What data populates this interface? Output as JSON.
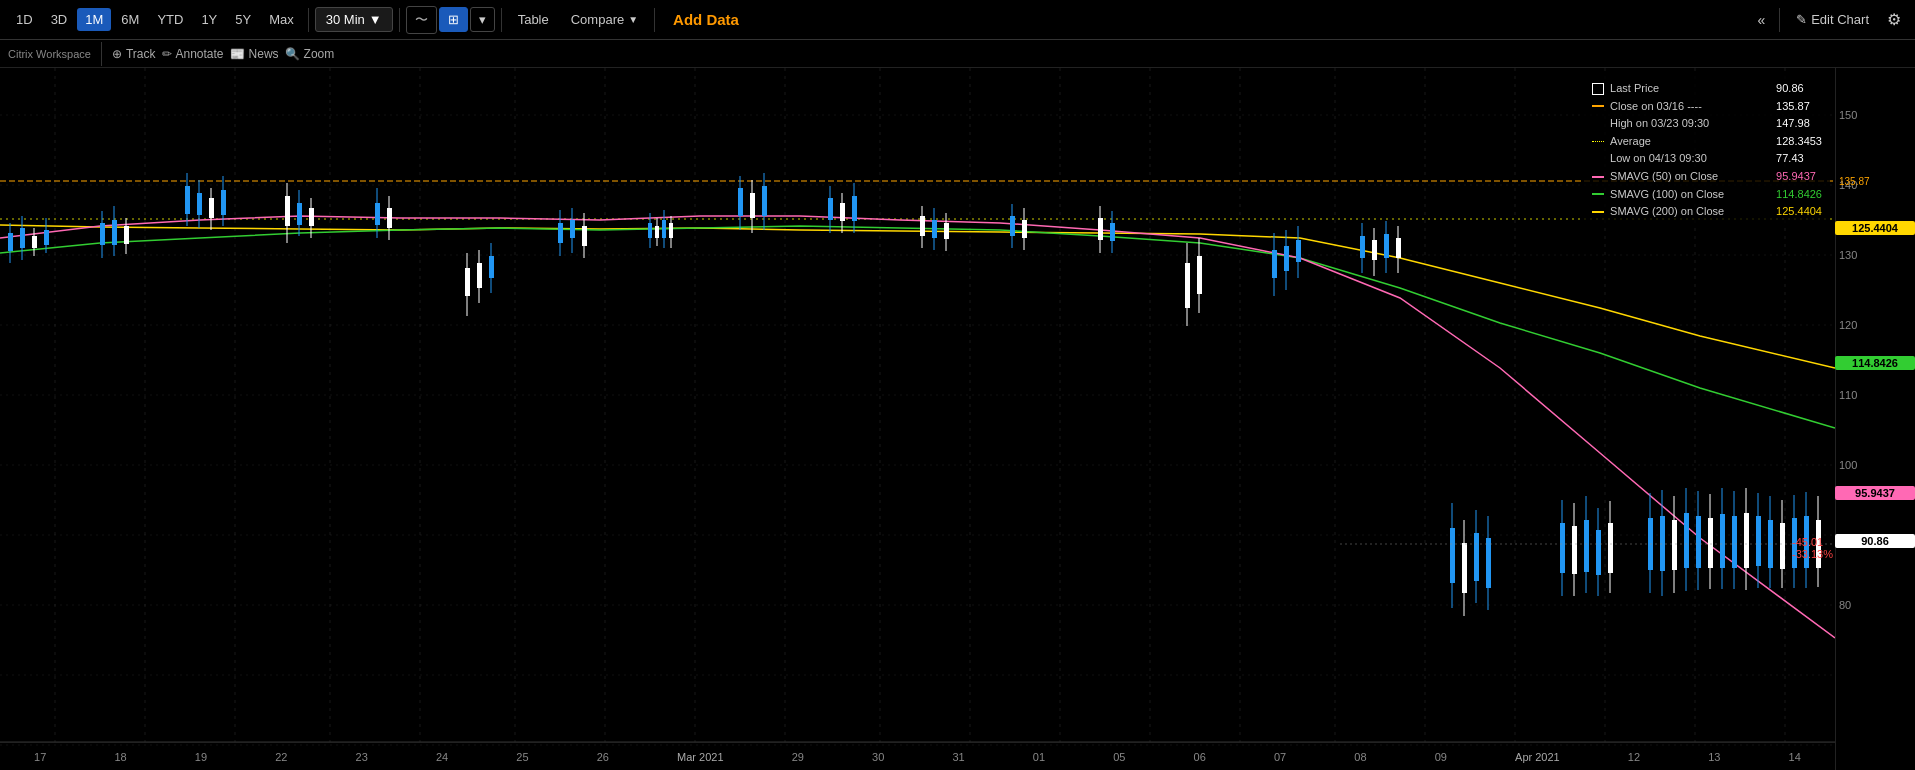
{
  "toolbar": {
    "timeframes": [
      "1D",
      "3D",
      "1M",
      "6M",
      "YTD",
      "1Y",
      "5Y",
      "Max"
    ],
    "active_timeframe": "1M",
    "interval": "30 Min",
    "table_label": "Table",
    "compare_label": "Compare",
    "add_data_label": "Add Data",
    "edit_chart_label": "Edit Chart"
  },
  "sub_toolbar": {
    "workspace_label": "Citrix Workspace",
    "track_label": "Track",
    "annotate_label": "Annotate",
    "news_label": "News",
    "zoom_label": "Zoom"
  },
  "legend": {
    "last_price_label": "Last Price",
    "last_price_value": "90.86",
    "close_label": "Close on 03/16 ----",
    "close_value": "135.87",
    "high_label": "High on 03/23 09:30",
    "high_value": "147.98",
    "avg_label": "Average",
    "avg_value": "128.3453",
    "low_label": "Low on 04/13 09:30",
    "low_value": "77.43",
    "smavg50_label": "SMAVG (50)  on Close",
    "smavg50_value": "95.9437",
    "smavg100_label": "SMAVG (100) on Close",
    "smavg100_value": "114.8426",
    "smavg200_label": "SMAVG (200) on Close",
    "smavg200_value": "125.4404"
  },
  "price_axis": {
    "labels": [
      "150",
      "140",
      "130",
      "120",
      "110",
      "100",
      "80"
    ],
    "values": [
      150,
      140,
      130,
      120,
      110,
      100,
      80
    ]
  },
  "x_axis": {
    "labels": [
      "17",
      "18",
      "19",
      "22",
      "23",
      "24",
      "25",
      "26",
      "29",
      "30",
      "31",
      "01",
      "05",
      "06",
      "07",
      "08",
      "09",
      "12",
      "13",
      "14"
    ],
    "mar_label": "Mar 2021",
    "apr_label": "Apr 2021"
  },
  "price_badges": {
    "smavg200_value": "125.4404",
    "smavg100_value": "114.8426",
    "smavg50_value": "95.9437",
    "last_price_value": "90.86",
    "change_value": "-45.01",
    "change_pct": "-33.13%"
  },
  "colors": {
    "background": "#000000",
    "bullish_candle": "#2196f3",
    "bearish_candle": "#ffffff",
    "smavg50": "#ff69b4",
    "smavg100": "#32cd32",
    "smavg200": "#ffd700",
    "close_line": "#ffa500",
    "avg_line": "#ffff00",
    "last_price_badge": "#ffffff",
    "smavg200_badge": "#ffd700",
    "smavg100_badge": "#32cd32",
    "smavg50_badge": "#ff69b4"
  }
}
